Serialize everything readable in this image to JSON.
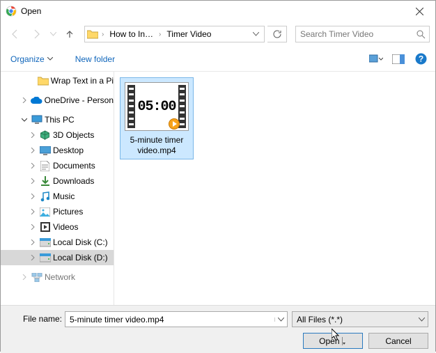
{
  "title": "Open",
  "nav": {
    "breadcrumb": [
      "How to In…",
      "Timer Video"
    ]
  },
  "search": {
    "placeholder": "Search Timer Video"
  },
  "toolbar": {
    "organize": "Organize",
    "new_folder": "New folder"
  },
  "sidebar": {
    "items": [
      {
        "label": "Wrap Text in a Pi",
        "depth": 2,
        "icon": "folder"
      },
      {
        "label": "OneDrive - Person",
        "depth": 1,
        "icon": "onedrive",
        "caret": "right",
        "gap_before": true
      },
      {
        "label": "This PC",
        "depth": 1,
        "icon": "thispc",
        "caret": "down",
        "gap_before": true
      },
      {
        "label": "3D Objects",
        "depth": 2,
        "icon": "3d",
        "caret": "right"
      },
      {
        "label": "Desktop",
        "depth": 2,
        "icon": "desktop",
        "caret": "right"
      },
      {
        "label": "Documents",
        "depth": 2,
        "icon": "documents",
        "caret": "right"
      },
      {
        "label": "Downloads",
        "depth": 2,
        "icon": "downloads",
        "caret": "right"
      },
      {
        "label": "Music",
        "depth": 2,
        "icon": "music",
        "caret": "right"
      },
      {
        "label": "Pictures",
        "depth": 2,
        "icon": "pictures",
        "caret": "right"
      },
      {
        "label": "Videos",
        "depth": 2,
        "icon": "videos",
        "caret": "right"
      },
      {
        "label": "Local Disk (C:)",
        "depth": 2,
        "icon": "disk",
        "caret": "right"
      },
      {
        "label": "Local Disk (D:)",
        "depth": 2,
        "icon": "disk",
        "caret": "right",
        "selected": true
      },
      {
        "label": "Network",
        "depth": 1,
        "icon": "network",
        "caret": "right",
        "gap_before": true,
        "faded": true
      }
    ]
  },
  "file": {
    "thumb_text": "05:00",
    "label_l1": "5-minute timer",
    "label_l2": "video.mp4"
  },
  "footer": {
    "filename_label": "File name:",
    "filename_value": "5-minute timer video.mp4",
    "filter_label": "All Files (*.*)",
    "open": "Open",
    "cancel": "Cancel"
  }
}
